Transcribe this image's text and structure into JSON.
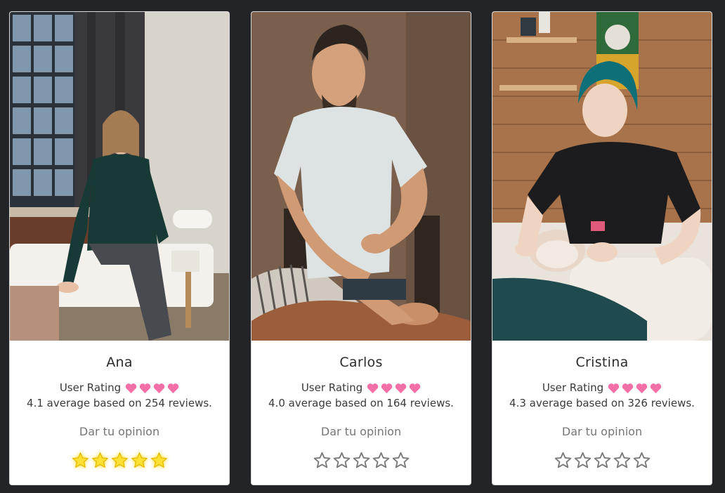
{
  "theme": {
    "page_bg": "#232428",
    "card_bg": "#ffffff",
    "heart_color": "#f26fa8",
    "star_active": "#ffe033",
    "star_inactive": "#7a7a7a"
  },
  "cards": [
    {
      "name": "Ana",
      "rating_label": "User Rating",
      "hearts": 4,
      "average_text": "4.1 average based on 254 reviews.",
      "opinion_label": "Dar tu opinion",
      "stars_total": 5,
      "stars_selected": 5,
      "photo_icon": "therapist-photo-woman-sitting-on-table"
    },
    {
      "name": "Carlos",
      "rating_label": "User Rating",
      "hearts": 4,
      "average_text": "4.0 average based on 164 reviews.",
      "opinion_label": "Dar tu opinion",
      "stars_total": 5,
      "stars_selected": 0,
      "photo_icon": "therapist-photo-man-massaging-back"
    },
    {
      "name": "Cristina",
      "rating_label": "User Rating",
      "hearts": 4,
      "average_text": "4.3 average based on 326 reviews.",
      "opinion_label": "Dar tu opinion",
      "stars_total": 5,
      "stars_selected": 0,
      "photo_icon": "therapist-photo-woman-facial-massage"
    }
  ]
}
